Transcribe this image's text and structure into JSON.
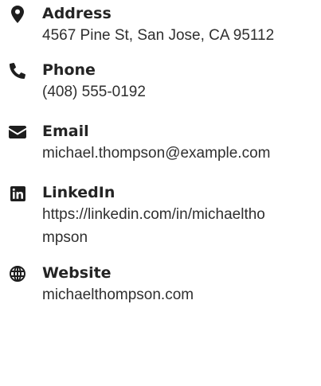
{
  "contact": {
    "items": [
      {
        "icon": "map-marker-icon",
        "label": "Address",
        "value": "4567 Pine St, San Jose, CA 95112"
      },
      {
        "icon": "phone-icon",
        "label": "Phone",
        "value": "(408) 555-0192"
      },
      {
        "icon": "envelope-icon",
        "label": "Email",
        "value": "michael.thompson@example.com"
      },
      {
        "icon": "linkedin-icon",
        "label": "LinkedIn",
        "value": "https://linkedin.com/in/michaelthompson"
      },
      {
        "icon": "globe-icon",
        "label": "Website",
        "value": "michaelthompson.com"
      }
    ]
  }
}
